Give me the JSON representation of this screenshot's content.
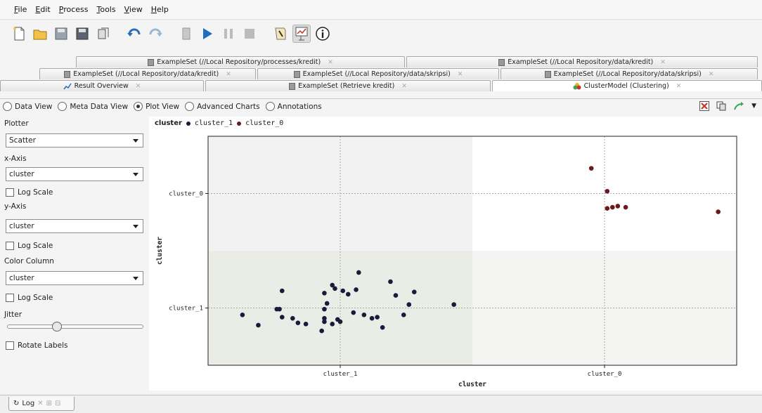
{
  "menu": [
    "File",
    "Edit",
    "Process",
    "Tools",
    "View",
    "Help"
  ],
  "toolbar_icons": [
    "new-icon",
    "open-icon",
    "save-icon",
    "save-as-icon",
    "export-icon",
    "undo-icon",
    "redo-icon",
    "stop-all-icon",
    "run-icon",
    "pause-icon",
    "stop-icon",
    "wizard-icon",
    "results-icon",
    "info-icon"
  ],
  "tabs": {
    "row1": [
      "ExampleSet (//Local Repository/processes/kredit)",
      "ExampleSet (//Local Repository/data/kredit)"
    ],
    "row2": [
      "ExampleSet (//Local Repository/data/kredit)",
      "ExampleSet (//Local Repository/data/skripsi)",
      "ExampleSet (//Local Repository/data/skripsi)"
    ],
    "row3": [
      "Result Overview",
      "ExampleSet (Retrieve kredit)",
      "ClusterModel (Clustering)"
    ]
  },
  "view_options": [
    "Data View",
    "Meta Data View",
    "Plot View",
    "Advanced Charts",
    "Annotations"
  ],
  "selected_view": "Plot View",
  "panel": {
    "plotter_label": "Plotter",
    "plotter_value": "Scatter",
    "xaxis_label": "x-Axis",
    "xaxis_value": "cluster",
    "log_scale": "Log Scale",
    "yaxis_label": "y-Axis",
    "yaxis_value": "cluster",
    "color_label": "Color Column",
    "color_value": "cluster",
    "jitter_label": "Jitter",
    "jitter_level": 0.35,
    "rotate_labels": "Rotate Labels"
  },
  "bottom": {
    "log_label": "Log"
  },
  "chart_data": {
    "type": "scatter",
    "title": "",
    "legend_title": "cluster",
    "xlabel": "cluster",
    "ylabel": "cluster",
    "categories": [
      "cluster_1",
      "cluster_0"
    ],
    "series": [
      {
        "name": "cluster_1",
        "color": "#1a1a3a",
        "points": [
          [
            -0.37,
            -0.06
          ],
          [
            -0.31,
            -0.15
          ],
          [
            -0.24,
            -0.01
          ],
          [
            -0.23,
            -0.01
          ],
          [
            -0.22,
            0.15
          ],
          [
            -0.22,
            -0.08
          ],
          [
            -0.18,
            -0.09
          ],
          [
            -0.16,
            -0.13
          ],
          [
            -0.13,
            -0.14
          ],
          [
            -0.07,
            -0.2
          ],
          [
            -0.06,
            0.13
          ],
          [
            -0.06,
            -0.01
          ],
          [
            -0.06,
            -0.12
          ],
          [
            -0.06,
            -0.09
          ],
          [
            -0.05,
            0.04
          ],
          [
            -0.03,
            -0.14
          ],
          [
            -0.03,
            0.2
          ],
          [
            -0.02,
            0.17
          ],
          [
            -0.01,
            -0.1
          ],
          [
            0.0,
            -0.12
          ],
          [
            0.01,
            0.15
          ],
          [
            0.03,
            0.12
          ],
          [
            0.05,
            -0.04
          ],
          [
            0.06,
            0.16
          ],
          [
            0.07,
            0.31
          ],
          [
            0.09,
            -0.06
          ],
          [
            0.12,
            -0.09
          ],
          [
            0.14,
            -0.08
          ],
          [
            0.16,
            -0.17
          ],
          [
            0.19,
            0.23
          ],
          [
            0.21,
            0.11
          ],
          [
            0.24,
            -0.06
          ],
          [
            0.26,
            0.03
          ],
          [
            0.28,
            0.14
          ],
          [
            0.43,
            0.03
          ]
        ]
      },
      {
        "name": "cluster_0",
        "color": "#6b1a1a",
        "points": [
          [
            -0.05,
            1.22
          ],
          [
            0.01,
            1.02
          ],
          [
            0.01,
            0.87
          ],
          [
            0.03,
            0.88
          ],
          [
            0.05,
            0.89
          ],
          [
            0.08,
            0.88
          ],
          [
            0.43,
            0.84
          ]
        ]
      }
    ]
  }
}
